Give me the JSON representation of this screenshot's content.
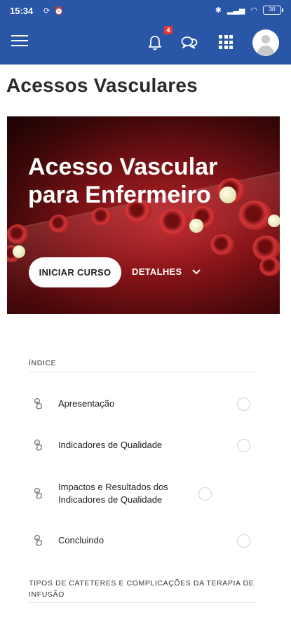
{
  "status_bar": {
    "time": "15:34",
    "battery": "30"
  },
  "app_bar": {
    "notification_count": "4"
  },
  "page_title": "Acessos Vasculares",
  "hero": {
    "title": "Acesso Vascular para Enfermeiro",
    "start_label": "INICIAR CURSO",
    "details_label": "DETALHES"
  },
  "index": {
    "heading": "ÍNDICE",
    "items": [
      {
        "label": "Apresentação"
      },
      {
        "label": "Indicadores de Qualidade"
      },
      {
        "label": "Impactos e Resultados dos Indicadores de Qualidade"
      },
      {
        "label": "Concluindo"
      }
    ],
    "next_section": "TIPOS DE CATETERES E COMPLICAÇÕES DA TERAPIA DE INFUSÃO"
  },
  "colors": {
    "primary": "#2a56a8",
    "badge": "#e53935"
  }
}
